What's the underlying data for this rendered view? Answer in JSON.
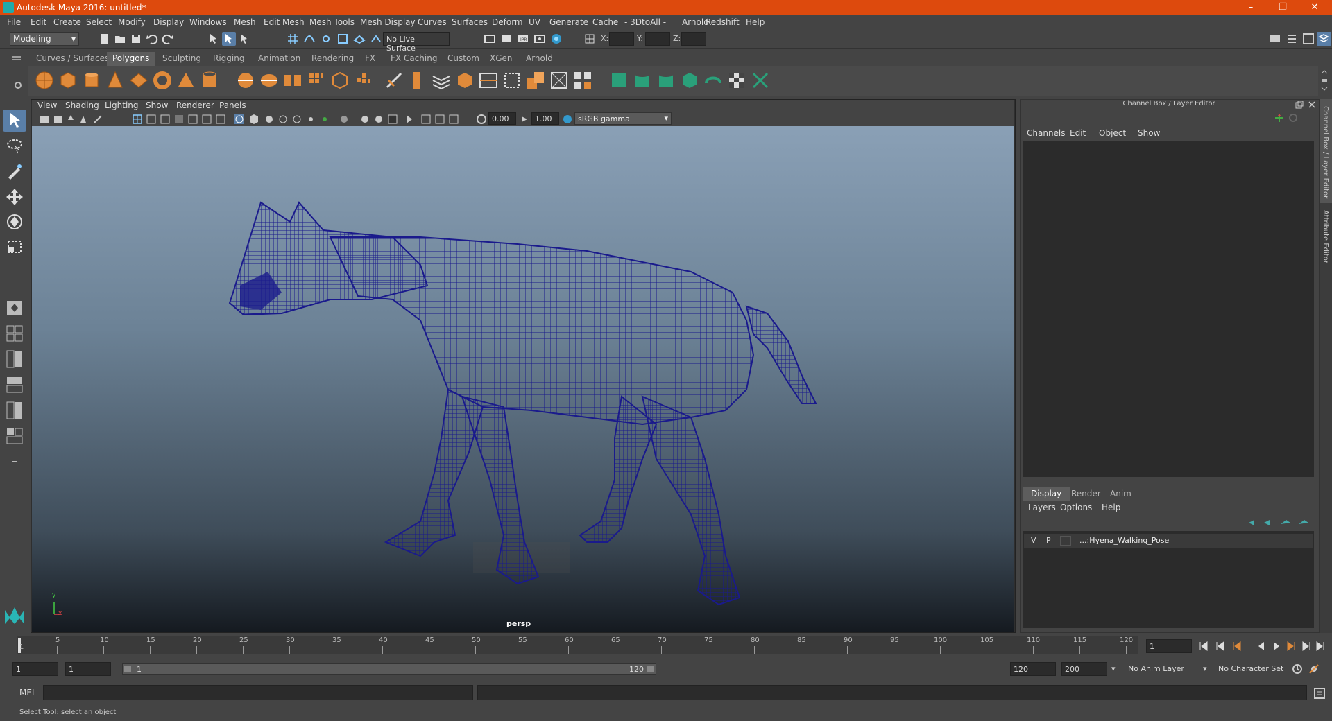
{
  "app": {
    "title": "Autodesk Maya 2016: untitled*"
  },
  "window_controls": {
    "minimize": "–",
    "maximize": "❐",
    "close": "✕"
  },
  "menubar": [
    "File",
    "Edit",
    "Create",
    "Select",
    "Modify",
    "Display",
    "Windows",
    "Mesh",
    "Edit Mesh",
    "Mesh Tools",
    "Mesh Display",
    "Curves",
    "Surfaces",
    "Deform",
    "UV",
    "Generate",
    "Cache",
    "- 3DtoAll -",
    "Arnold",
    "Redshift",
    "Help"
  ],
  "statusline": {
    "mode": "Modeling",
    "live_surface": "No Live Surface",
    "x_label": "X:",
    "y_label": "Y:",
    "z_label": "Z:"
  },
  "shelf_tabs": [
    "Curves / Surfaces",
    "Polygons",
    "Sculpting",
    "Rigging",
    "Animation",
    "Rendering",
    "FX",
    "FX Caching",
    "Custom",
    "XGen",
    "Arnold"
  ],
  "shelf_active_tab": "Polygons",
  "viewport": {
    "menu": [
      "View",
      "Shading",
      "Lighting",
      "Show",
      "Renderer",
      "Panels"
    ],
    "exposure": "0.00",
    "gamma": "1.00",
    "color_space": "sRGB gamma",
    "camera_label": "persp",
    "axis_y": "y",
    "axis_x": "x"
  },
  "channel_box": {
    "header": "Channel Box / Layer Editor",
    "menu": [
      "Channels",
      "Edit",
      "Object",
      "Show"
    ]
  },
  "layer_editor": {
    "tabs": [
      "Display",
      "Render",
      "Anim"
    ],
    "active_tab": "Display",
    "menu": [
      "Layers",
      "Options",
      "Help"
    ],
    "layers": [
      {
        "v": "V",
        "p": "P",
        "name": "...:Hyena_Walking_Pose"
      }
    ]
  },
  "side_tabs": [
    "Channel Box / Layer Editor",
    "Attribute Editor"
  ],
  "timeline": {
    "ticks": [
      "1",
      "5",
      "10",
      "15",
      "20",
      "25",
      "30",
      "35",
      "40",
      "45",
      "50",
      "55",
      "60",
      "65",
      "70",
      "75",
      "80",
      "85",
      "90",
      "95",
      "100",
      "105",
      "110",
      "115",
      "120"
    ],
    "current_frame": "1"
  },
  "range": {
    "start": "1",
    "anim_start": "1",
    "range_start": "1",
    "range_end": "120",
    "anim_end": "120",
    "end": "200",
    "anim_layer": "No Anim Layer",
    "character_set": "No Character Set"
  },
  "command_line": {
    "label": "MEL"
  },
  "help_line": {
    "text": "Select Tool: select an object"
  },
  "colors": {
    "title_bar": "#dd4a0d",
    "wireframe": "#1a1a8c",
    "accent_select": "#5a7fa8"
  }
}
